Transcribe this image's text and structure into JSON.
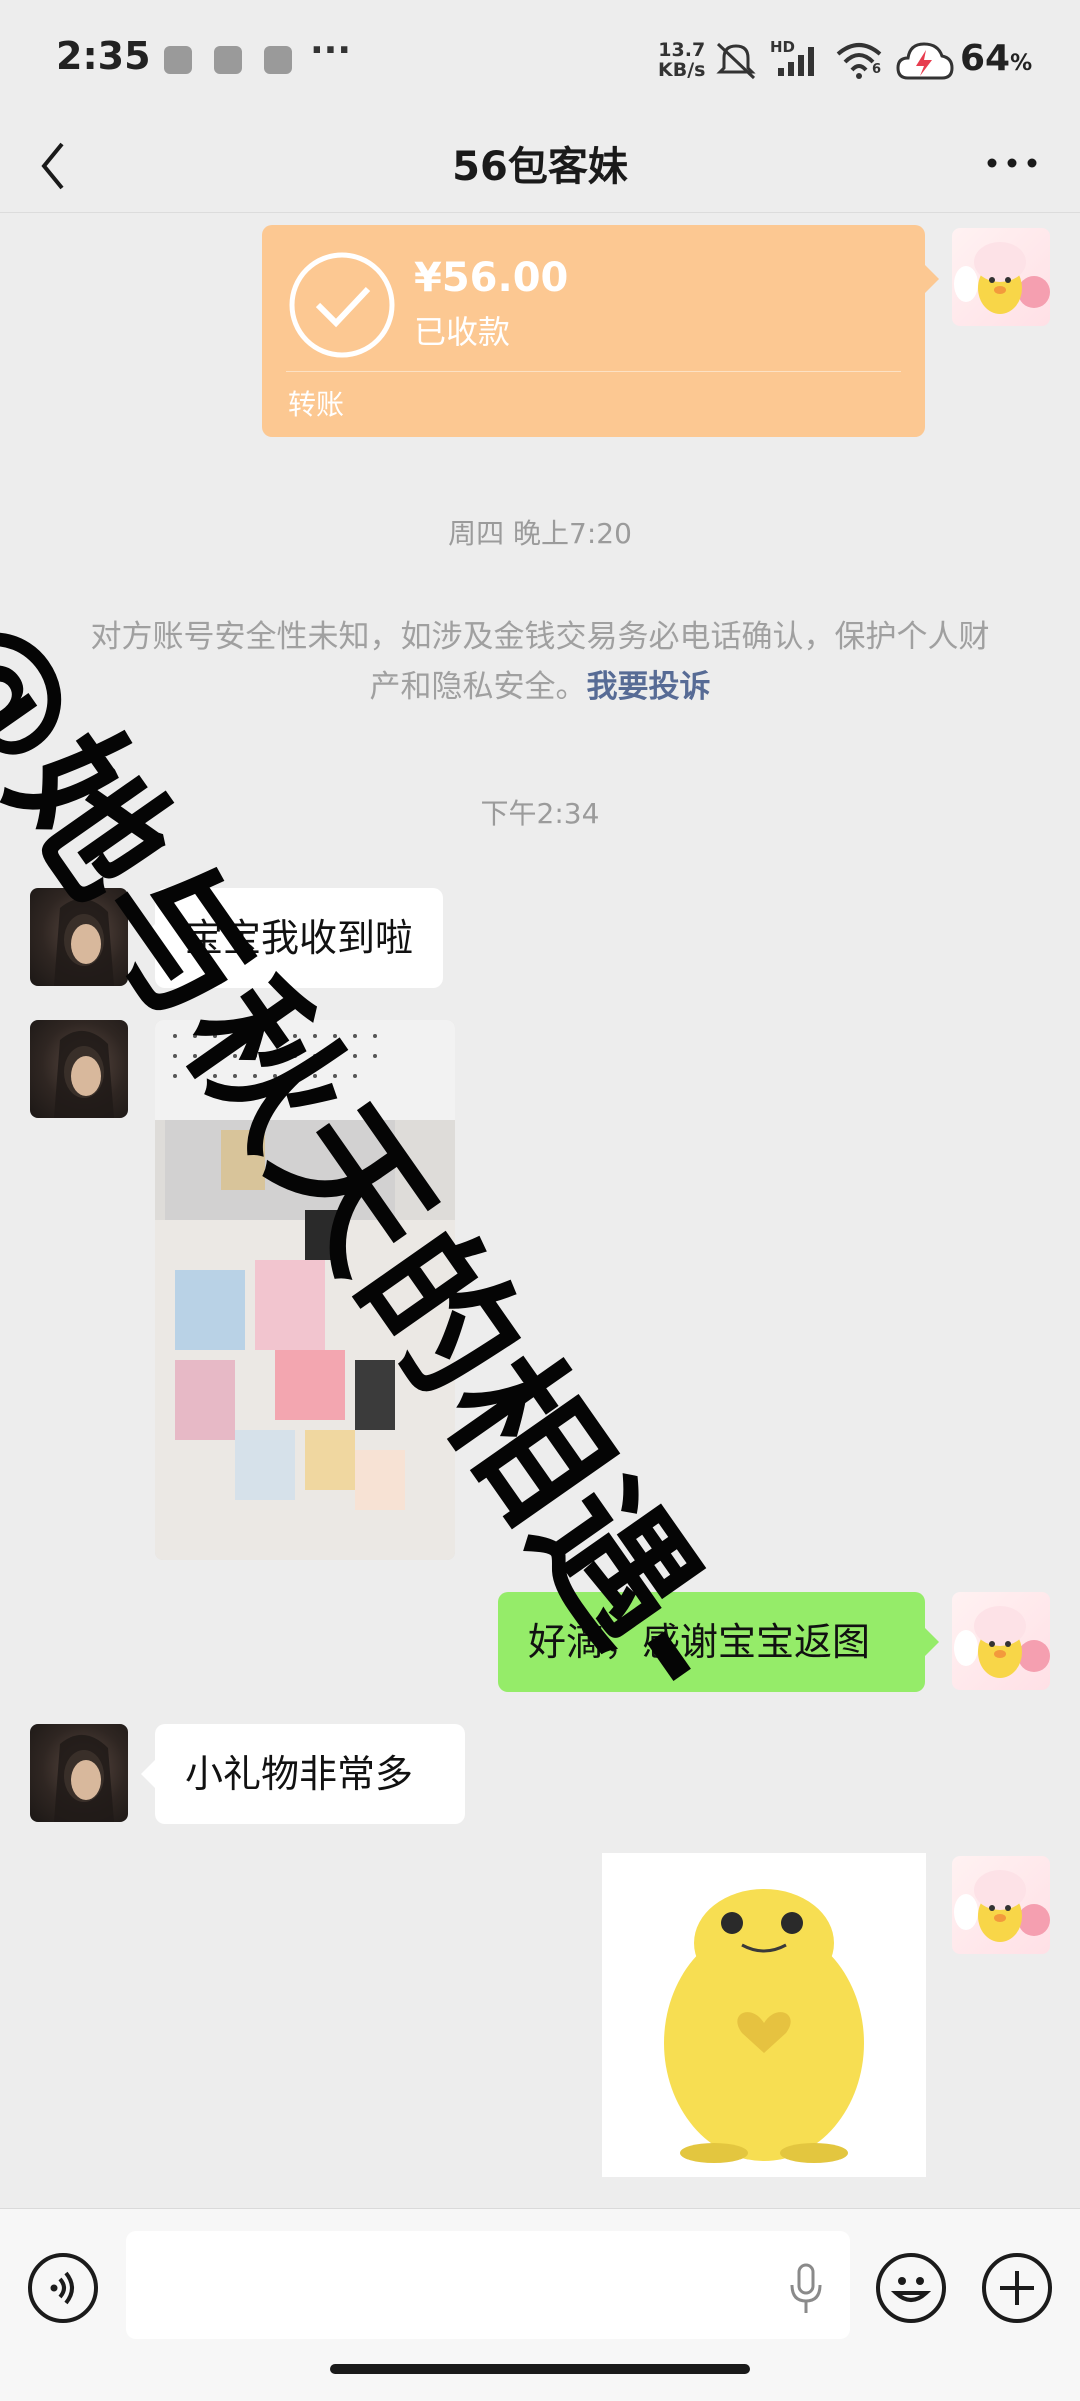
{
  "status_bar": {
    "time": "2:35",
    "more": "···",
    "net_speed_value": "13.7",
    "net_speed_unit": "KB/s",
    "hd_label": "HD",
    "wifi_label": "6",
    "battery_percent": "64",
    "battery_unit": "%"
  },
  "header": {
    "title": "56包客妹",
    "back_icon": "chevron-left-icon",
    "more_icon": "more-dots-icon"
  },
  "transfer": {
    "amount": "¥56.00",
    "status": "已收款",
    "label": "转账",
    "color": "#fcc892"
  },
  "timestamps": {
    "first": "周四 晚上7:20",
    "second": "下午2:34"
  },
  "notice": {
    "text": "对方账号安全性未知，如涉及金钱交易务必电话确认，保护个人财产和隐私安全。",
    "link": "我要投诉"
  },
  "messages": [
    {
      "side": "left",
      "text": "宝宝我收到啦"
    },
    {
      "side": "left",
      "type": "image"
    },
    {
      "side": "right",
      "text": "好滴，感谢宝宝返图"
    },
    {
      "side": "left",
      "text": "小礼物非常多"
    },
    {
      "side": "right",
      "type": "sticker"
    }
  ],
  "input_bar": {
    "voice_icon": "voice-icon",
    "mic_icon": "mic-icon",
    "emoji_icon": "emoji-icon",
    "plus_icon": "plus-icon"
  },
  "watermark": "@她与秋天的相遇-",
  "colors": {
    "background": "#ededed",
    "bubble_right": "#95ec69",
    "bubble_left": "#ffffff",
    "link": "#576b95"
  }
}
